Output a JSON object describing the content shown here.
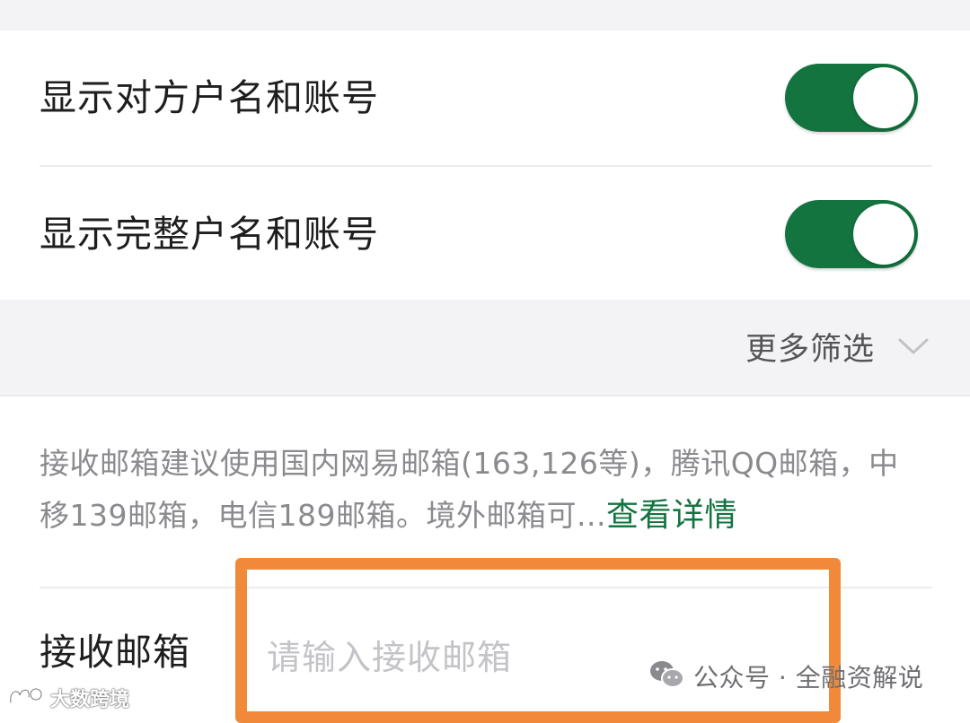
{
  "toggles": [
    {
      "label": "显示对方户名和账号",
      "on": true
    },
    {
      "label": "显示完整户名和账号",
      "on": true
    }
  ],
  "filter": {
    "more_label": "更多筛选",
    "icon": "chevron-down-icon"
  },
  "notice": {
    "text": "接收邮箱建议使用国内网易邮箱(163,126等)，腾讯QQ邮箱，中移139邮箱，电信189邮箱。境外邮箱可...",
    "link": "查看详情"
  },
  "email": {
    "label": "接收邮箱",
    "placeholder": "请输入接收邮箱"
  },
  "watermarks": {
    "wechat": "公众号 · 全融资解说",
    "left": "大数跨境"
  },
  "colors": {
    "accent": "#137440",
    "highlight": "#f08a3a",
    "band": "#f3f3f6"
  }
}
